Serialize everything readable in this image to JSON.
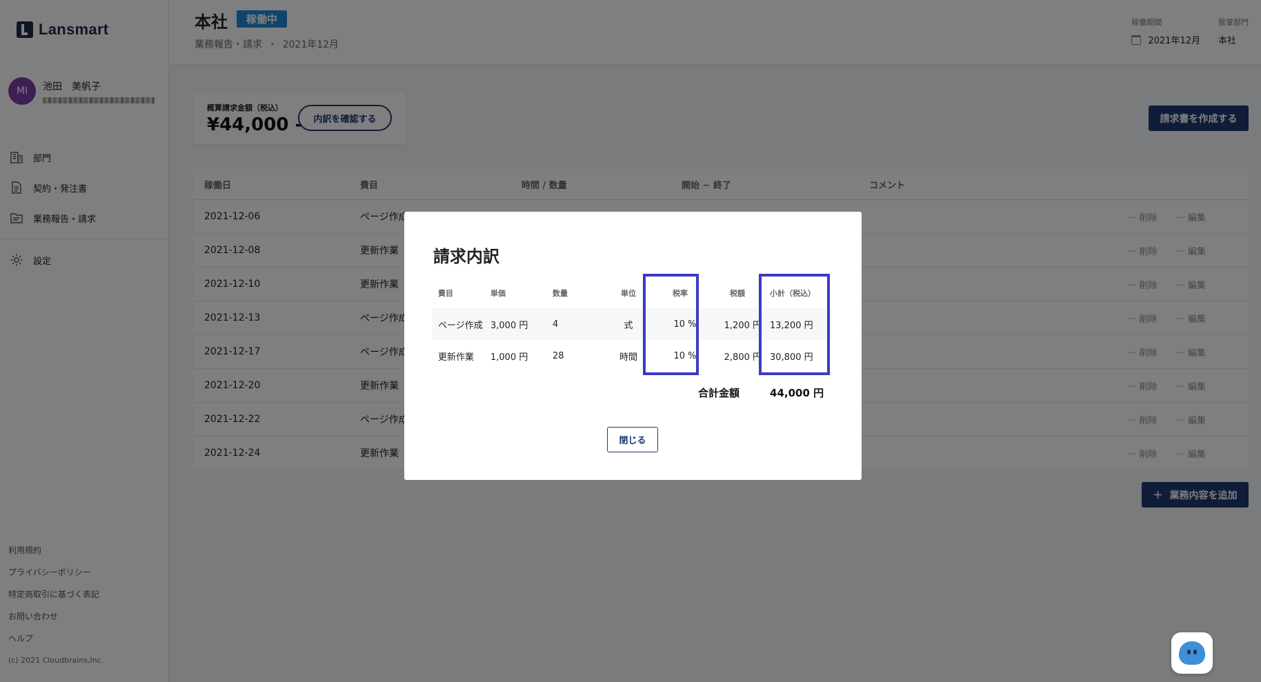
{
  "app": {
    "logo": "Lansmart"
  },
  "user": {
    "initials": "MI",
    "name": "池田　美帆子"
  },
  "sidebar": {
    "items": [
      {
        "label": "部門",
        "icon": "building-icon"
      },
      {
        "label": "契約・発注書",
        "icon": "document-icon"
      },
      {
        "label": "業務報告・請求",
        "icon": "folder-icon"
      },
      {
        "label": "設定",
        "icon": "gear-icon"
      }
    ],
    "footer": [
      "利用規約",
      "プライバシーポリシー",
      "特定商取引に基づく表記",
      "お問い合わせ",
      "ヘルプ"
    ],
    "copyright": "(c) 2021 Cloudbrains,Inc."
  },
  "header": {
    "title": "本社",
    "status": "稼働中",
    "breadcrumb": [
      "業務報告・請求",
      "2021年12月"
    ],
    "period_label": "稼働期間",
    "period_value": "2021年12月",
    "dept_label": "管掌部門",
    "dept_value": "本社"
  },
  "summary": {
    "label": "概算請求金額（税込）",
    "amount": "¥44,000 -",
    "breakdown_button": "内訳を確認する"
  },
  "actions": {
    "create_invoice": "請求書を作成する",
    "add_work": "業務内容を追加"
  },
  "table": {
    "headers": [
      "稼働日",
      "費目",
      "時間 / 数量",
      "開始 ~ 終了",
      "コメント"
    ],
    "rows": [
      {
        "date": "2021-12-06",
        "item": "ページ作成"
      },
      {
        "date": "2021-12-08",
        "item": "更新作業"
      },
      {
        "date": "2021-12-10",
        "item": "更新作業"
      },
      {
        "date": "2021-12-13",
        "item": "ページ作成"
      },
      {
        "date": "2021-12-17",
        "item": "ページ作成"
      },
      {
        "date": "2021-12-20",
        "item": "更新作業"
      },
      {
        "date": "2021-12-22",
        "item": "ページ作成"
      },
      {
        "date": "2021-12-24",
        "item": "更新作業"
      }
    ],
    "row_actions": {
      "delete": "削除",
      "edit": "編集"
    }
  },
  "modal": {
    "title": "請求内訳",
    "headers": [
      "費目",
      "単価",
      "数量",
      "単位",
      "税率",
      "税額",
      "小計（税込）"
    ],
    "rows": [
      [
        "ページ作成",
        "3,000 円",
        "4",
        "式",
        "10 %",
        "1,200 円",
        "13,200 円"
      ],
      [
        "更新作業",
        "1,000 円",
        "28",
        "時間",
        "10 %",
        "2,800 円",
        "30,800 円"
      ]
    ],
    "total_label": "合計金額",
    "total_value": "44,000 円",
    "close": "閉じる",
    "highlight_color": "#3b3bc4"
  },
  "colors": {
    "primary": "#1e3a72",
    "badge": "#1f8ad6",
    "avatar": "#7b3fa8"
  }
}
